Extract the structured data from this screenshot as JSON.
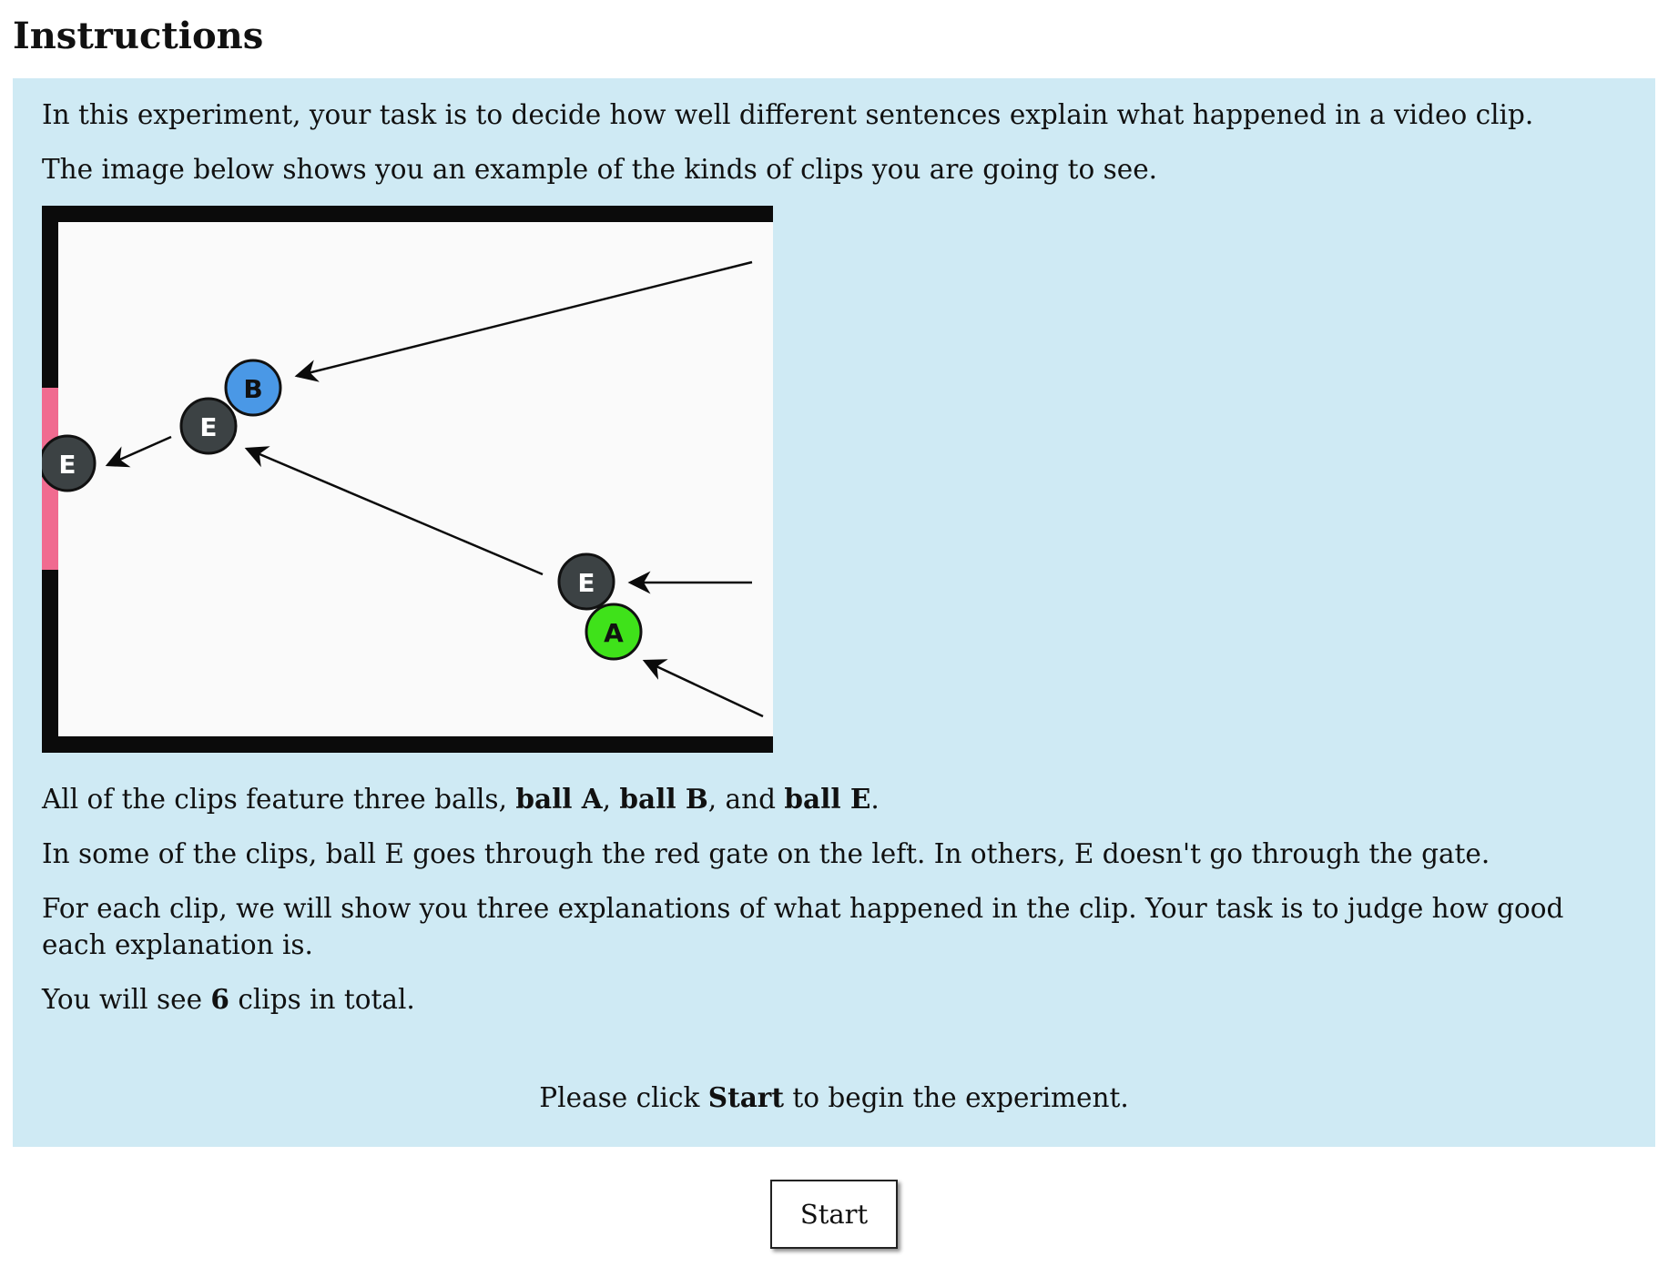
{
  "heading": "Instructions",
  "intro": {
    "line1": "In this experiment, your task is to decide how well different sentences explain what happened in a video clip.",
    "line2": "The image below shows you an example of the kinds of clips you are going to see."
  },
  "figure": {
    "balls": {
      "b": "B",
      "e_upper": "E",
      "e_left": "E",
      "e_lower": "E",
      "a": "A"
    },
    "colors": {
      "wall": "#0b0b0b",
      "gate": "#f06b90",
      "ball_a": "#3fe21a",
      "ball_b": "#4a98e6",
      "ball_e": "#3c4244",
      "field": "#fafafa"
    }
  },
  "features": {
    "prefix": "All of the clips feature three balls, ",
    "ball_a": "ball A",
    "sep1": ", ",
    "ball_b": "ball B",
    "sep2": ", and ",
    "ball_e": "ball E",
    "suffix": "."
  },
  "gate_text": "In some of the clips, ball E goes through the red gate on the left. In others, E doesn't go through the gate.",
  "task_text": "For each clip, we will show you three explanations of what happened in the clip. Your task is to judge how good each explanation is.",
  "total": {
    "prefix": "You will see ",
    "count": "6",
    "suffix": " clips in total."
  },
  "prompt": {
    "prefix": "Please click ",
    "bold": "Start",
    "suffix": " to begin the experiment."
  },
  "start_button": "Start"
}
